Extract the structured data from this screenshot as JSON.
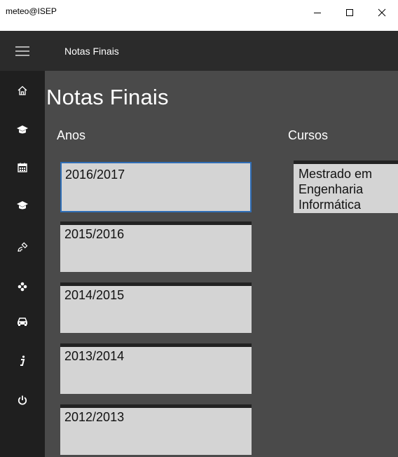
{
  "window": {
    "title": "meteo@ISEP",
    "minimize_label": "—",
    "maximize_label": "☐",
    "close_label": "✕"
  },
  "appbar": {
    "title": "Notas Finais"
  },
  "nav": {
    "items": [
      {
        "icon": "home-icon"
      },
      {
        "icon": "graduation-cap-icon"
      },
      {
        "icon": "calendar-icon"
      },
      {
        "icon": "graduation-cap-icon"
      },
      {
        "icon": "satellite-icon"
      },
      {
        "icon": "flower-icon"
      },
      {
        "icon": "car-icon"
      },
      {
        "icon": "info-icon"
      },
      {
        "icon": "power-icon"
      }
    ]
  },
  "page": {
    "title": "Notas Finais",
    "anos_label": "Anos",
    "cursos_label": "Cursos"
  },
  "anos": [
    {
      "label": "2016/2017"
    },
    {
      "label": "2015/2016"
    },
    {
      "label": "2014/2015"
    },
    {
      "label": "2013/2014"
    },
    {
      "label": "2012/2013"
    }
  ],
  "cursos": [
    {
      "label": "Mestrado em Engenharia Informática"
    }
  ],
  "colors": {
    "selection_border": "#2f6db5",
    "content_bg": "#4a4a4a",
    "rail_bg": "#1f1f1f",
    "appbar_bg": "#2b2b2b"
  }
}
